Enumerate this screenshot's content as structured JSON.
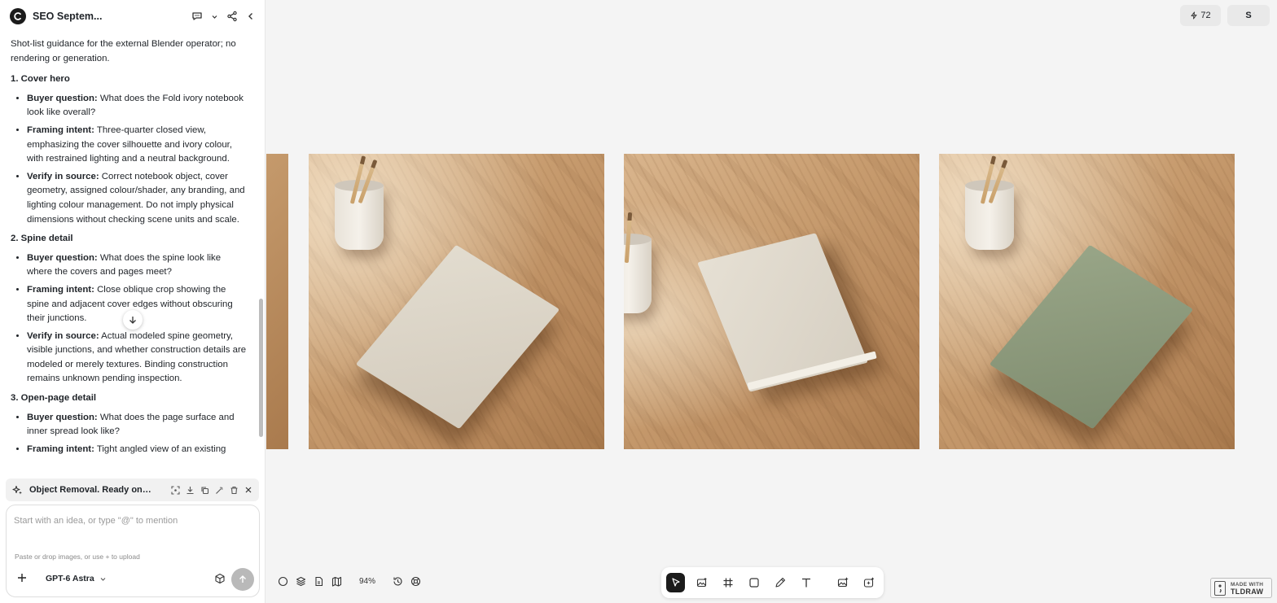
{
  "header": {
    "title": "SEO Septem..."
  },
  "content": {
    "intro": "Shot-list guidance for the external Blender operator; no rendering or generation.",
    "sections": [
      {
        "heading": "1. Cover hero",
        "items": [
          {
            "label": "Buyer question:",
            "text": " What does the Fold ivory notebook look like overall?"
          },
          {
            "label": "Framing intent:",
            "text": " Three-quarter closed view, emphasizing the cover silhouette and ivory colour, with restrained lighting and a neutral background."
          },
          {
            "label": "Verify in source:",
            "text": " Correct notebook object, cover geometry, assigned colour/shader, any branding, and lighting colour management. Do not imply physical dimensions without checking scene units and scale."
          }
        ]
      },
      {
        "heading": "2. Spine detail",
        "items": [
          {
            "label": "Buyer question:",
            "text": " What does the spine look like where the covers and pages meet?"
          },
          {
            "label": "Framing intent:",
            "text": " Close oblique crop showing the spine and adjacent cover edges without obscuring their junctions."
          },
          {
            "label": "Verify in source:",
            "text": " Actual modeled spine geometry, visible junctions, and whether construction details are modeled or merely textures. Binding construction remains unknown pending inspection."
          }
        ]
      },
      {
        "heading": "3. Open-page detail",
        "items": [
          {
            "label": "Buyer question:",
            "text": " What does the page surface and inner spread look like?"
          },
          {
            "label": "Framing intent:",
            "text": " Tight angled view of an existing"
          }
        ]
      }
    ]
  },
  "attachment": {
    "label": "Object Removal. Ready on c..."
  },
  "composer": {
    "placeholder": "Start with an idea, or type \"@\" to mention",
    "hint": "Paste or drop images, or use + to upload",
    "model": "GPT-6 Astra"
  },
  "topbar": {
    "credits": "72",
    "user_initial": "S"
  },
  "canvas": {
    "zoom": "94%",
    "photos": [
      {
        "name": "ivory-notebook-three-quarter",
        "cover_color": "#d8d1c4"
      },
      {
        "name": "ivory-notebook-spine",
        "cover_color": "#dcd6ca"
      },
      {
        "name": "sage-notebook-three-quarter",
        "cover_color": "#8e9a7d"
      }
    ]
  },
  "badge": {
    "line1": "MADE WITH",
    "line2": "TLDRAW"
  },
  "colors": {
    "accent_dark": "#1b1b1b",
    "panel_bg": "#ffffff",
    "canvas_bg": "#f4f4f4"
  }
}
